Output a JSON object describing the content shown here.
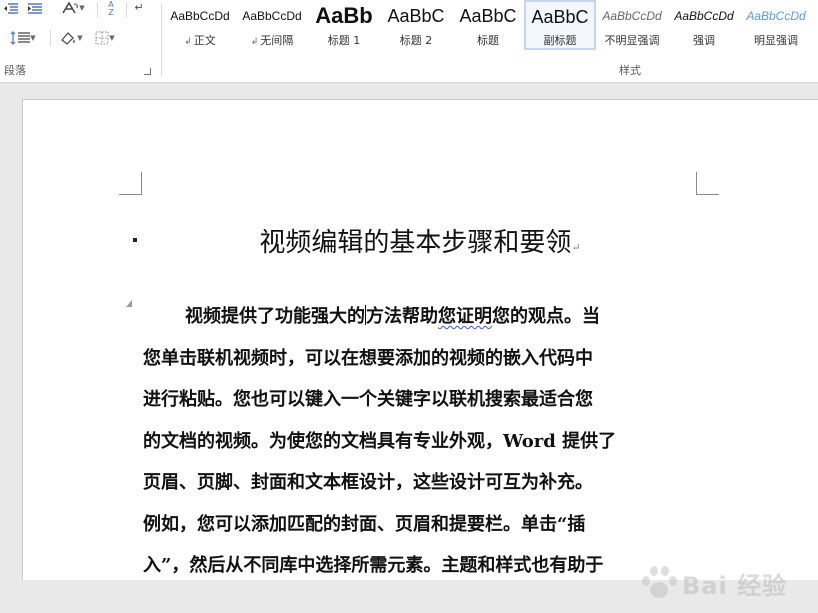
{
  "ribbon": {
    "paragraph_group": {
      "label": "段落",
      "icons": [
        "decrease-indent-icon",
        "increase-indent-icon",
        "asian-layout-icon",
        "sort-icon",
        "paragraph-mark-icon",
        "line-spacing-icon",
        "shading-icon",
        "borders-icon"
      ],
      "sort_glyph_top": "A",
      "sort_glyph_bottom": "Z"
    },
    "styles_group": {
      "label": "样式",
      "items": [
        {
          "preview": "AaBbCcDd",
          "name": "正文",
          "mark": "↲"
        },
        {
          "preview": "AaBbCcDd",
          "name": "无间隔",
          "mark": "↲"
        },
        {
          "preview": "AaBb",
          "name": "标题 1",
          "mark": ""
        },
        {
          "preview": "AaBbC",
          "name": "标题 2",
          "mark": ""
        },
        {
          "preview": "AaBbC",
          "name": "标题",
          "mark": ""
        },
        {
          "preview": "AaBbC",
          "name": "副标题",
          "mark": ""
        },
        {
          "preview": "AaBbCcDd",
          "name": "不明显强调",
          "mark": ""
        },
        {
          "preview": "AaBbCcDd",
          "name": "强调",
          "mark": ""
        },
        {
          "preview": "AaBbCcDd",
          "name": "明显强调",
          "mark": ""
        }
      ],
      "selected_index": 5
    }
  },
  "document": {
    "title": "视频编辑的基本步骤和要领",
    "paragraph_mark": "↵",
    "lines": [
      {
        "before": "视频提供了功能强大的",
        "after_cursor": "方法帮助",
        "squiggle": "您证明",
        "rest": "您的观点。当"
      },
      {
        "text": "您单击联机视频时，可以在想要添加的视频的嵌入代码中"
      },
      {
        "text": "进行粘贴。您也可以键入一个关键字以联机搜索最适合您"
      },
      {
        "text": "的文档的视频。为使您的文档具有专业外观，Word 提供了"
      },
      {
        "text": "页眉、页脚、封面和文本框设计，这些设计可互为补充。"
      },
      {
        "text": "例如，您可以添加匹配的封面、页眉和提要栏。单击“插"
      },
      {
        "text": "入”，然后从不同库中选择所需元素。主题和样式也有助于"
      }
    ]
  },
  "watermark": {
    "text": "Bai 经验"
  },
  "colors": {
    "ribbon_bg": "#ffffff",
    "doc_bg": "#e9e9e9",
    "page_bg": "#ffffff",
    "selected_style_border": "#c3d7ee",
    "squiggle": "#3b5bdb"
  }
}
